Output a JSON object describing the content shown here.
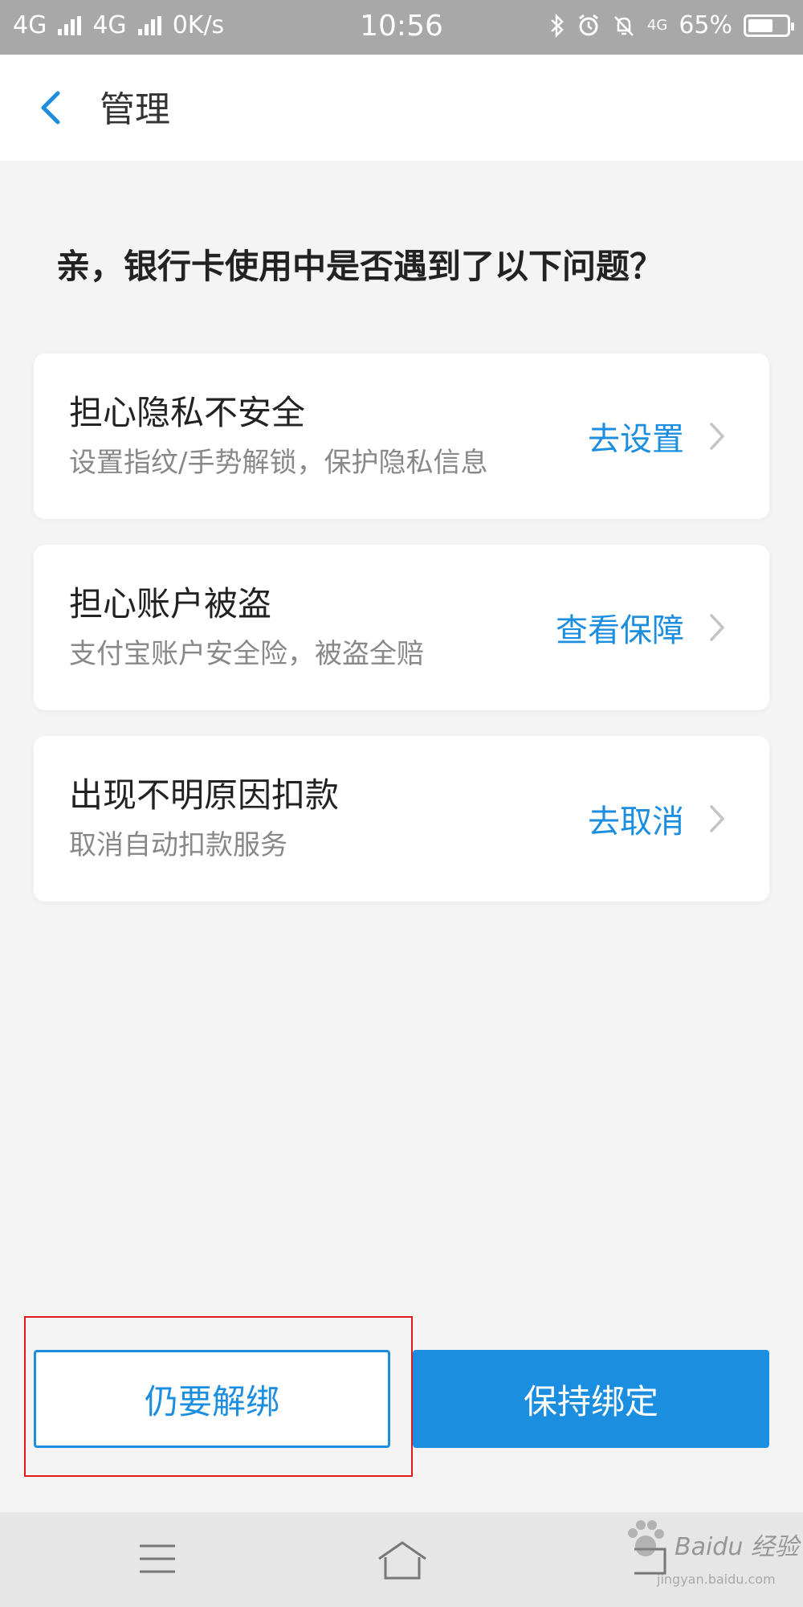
{
  "status_bar": {
    "net1": "4G",
    "net2": "4G",
    "speed": "0K/s",
    "time": "10:56",
    "net3": "4G",
    "battery_pct": "65%",
    "battery_level": 0.65
  },
  "nav": {
    "title": "管理",
    "back_icon": "chevron-left-icon"
  },
  "question": "亲，银行卡使用中是否遇到了以下问题？",
  "cards": [
    {
      "title": "担心隐私不安全",
      "desc": "设置指纹/手势解锁，保护隐私信息",
      "action": "去设置"
    },
    {
      "title": "担心账户被盗",
      "desc": "支付宝账户安全险，被盗全赔",
      "action": "查看保障"
    },
    {
      "title": "出现不明原因扣款",
      "desc": "取消自动扣款服务",
      "action": "去取消"
    }
  ],
  "buttons": {
    "unbind": "仍要解绑",
    "keep": "保持绑定"
  },
  "watermark": {
    "text": "Baidu 经验",
    "sub": "jingyan.baidu.com"
  },
  "colors": {
    "accent": "#1c8ee0",
    "highlight": "#e01b1b",
    "status_bar": "#a8a8a8"
  }
}
